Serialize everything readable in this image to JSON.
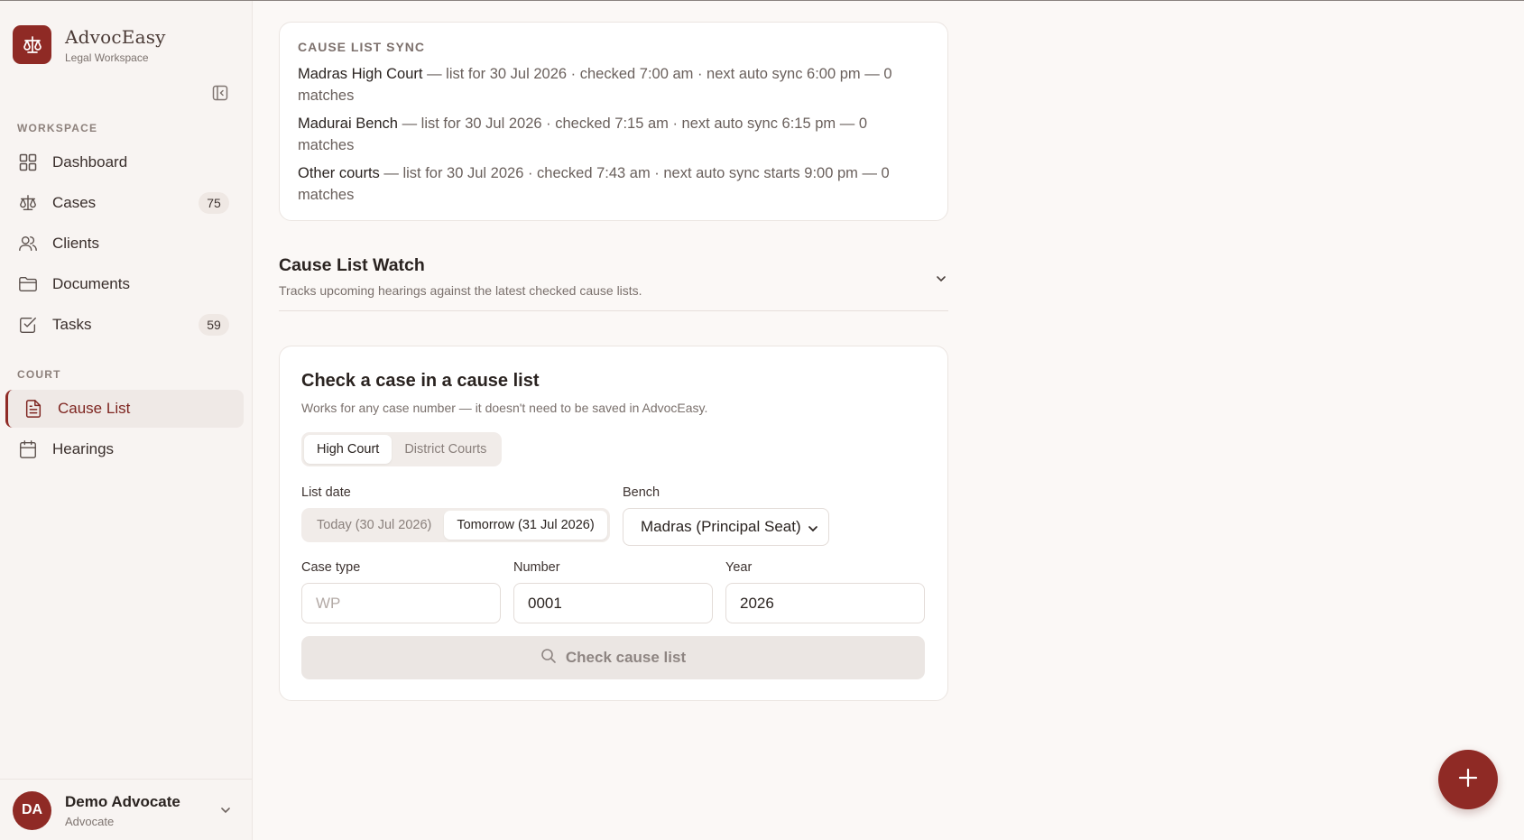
{
  "app": {
    "name": "AdvocEasy",
    "subtitle": "Legal Workspace"
  },
  "colors": {
    "brand": "#8f2a25",
    "background": "#fbf8f6",
    "sidebar": "#f8f4f2"
  },
  "sidebar": {
    "workspace_label": "WORKSPACE",
    "workspace_items": [
      {
        "label": "Dashboard",
        "icon": "grid-icon"
      },
      {
        "label": "Cases",
        "icon": "scales-icon",
        "count": "75"
      },
      {
        "label": "Clients",
        "icon": "users-icon"
      },
      {
        "label": "Documents",
        "icon": "folder-icon"
      },
      {
        "label": "Tasks",
        "icon": "checkbox-icon",
        "count": "59"
      }
    ],
    "court_label": "COURT",
    "court_items": [
      {
        "label": "Cause List",
        "icon": "document-icon",
        "active": true
      },
      {
        "label": "Hearings",
        "icon": "calendar-icon"
      }
    ]
  },
  "user": {
    "initials": "DA",
    "name": "Demo Advocate",
    "role": "Advocate"
  },
  "sync": {
    "title": "CAUSE LIST SYNC",
    "lines": [
      {
        "court": "Madras High Court",
        "detail": " — list for 30 Jul 2026 · checked 7:00 am · next auto sync 6:00 pm — 0 matches"
      },
      {
        "court": "Madurai Bench",
        "detail": " — list for 30 Jul 2026 · checked 7:15 am · next auto sync 6:15 pm — 0 matches"
      },
      {
        "court": "Other courts",
        "detail": " — list for 30 Jul 2026 · checked 7:43 am · next auto sync starts 9:00 pm — 0 matches"
      }
    ]
  },
  "watch": {
    "title": "Cause List Watch",
    "subtitle": "Tracks upcoming hearings against the latest checked cause lists."
  },
  "check": {
    "title": "Check a case in a cause list",
    "subtitle": "Works for any case number — it doesn't need to be saved in AdvocEasy.",
    "court_tabs": [
      "High Court",
      "District Courts"
    ],
    "selected_court_tab": "High Court",
    "list_date_label": "List date",
    "date_options": [
      "Today (30 Jul 2026)",
      "Tomorrow (31 Jul 2026)"
    ],
    "selected_date": "Tomorrow (31 Jul 2026)",
    "bench_label": "Bench",
    "bench_value": "Madras (Principal Seat)",
    "case_type_label": "Case type",
    "case_type_placeholder": "WP",
    "number_label": "Number",
    "number_value": "0001",
    "year_label": "Year",
    "year_value": "2026",
    "button_label": "Check cause list"
  }
}
